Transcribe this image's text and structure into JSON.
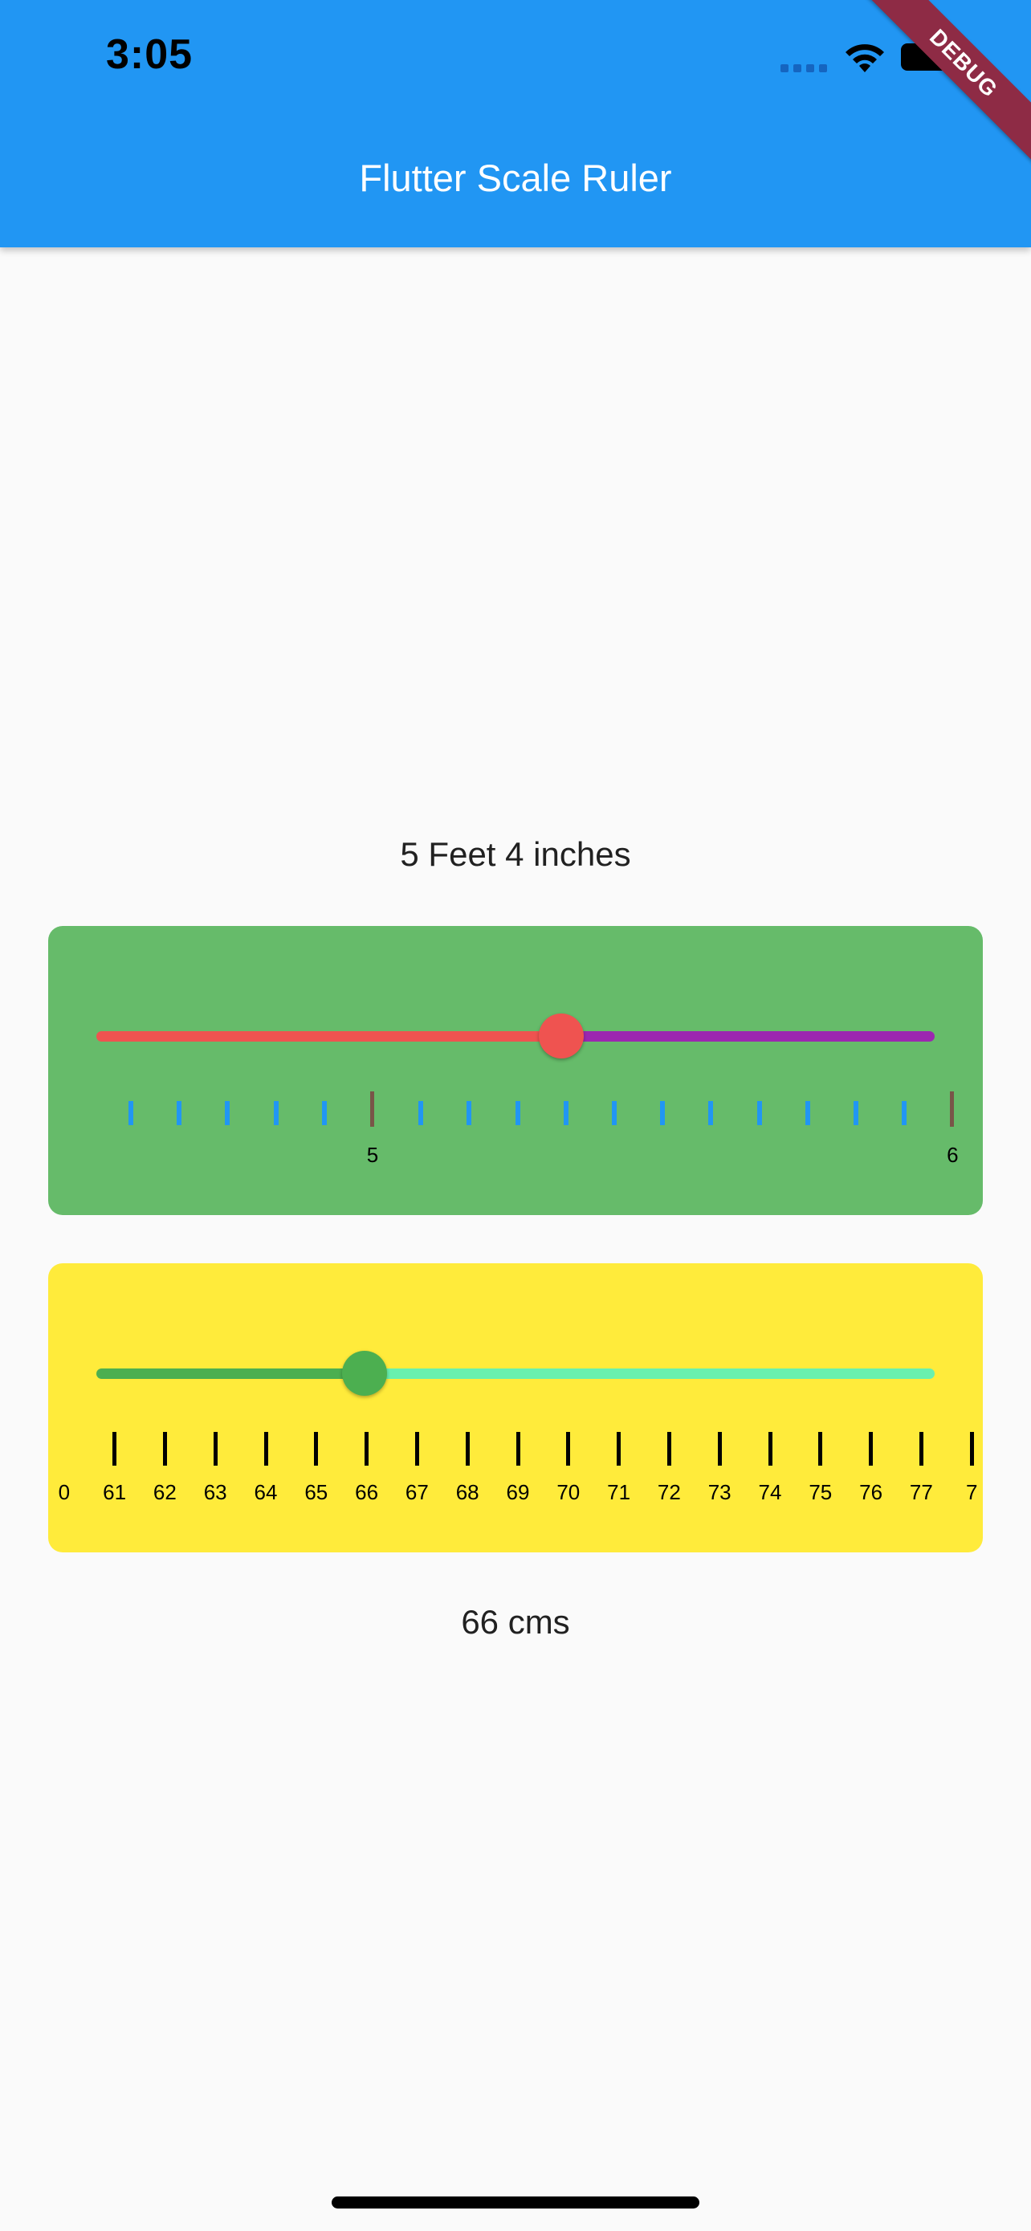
{
  "status_bar": {
    "time": "3:05",
    "icons": [
      "cellular-signal-icon",
      "wifi-icon",
      "battery-icon"
    ]
  },
  "app_bar": {
    "title": "Flutter Scale Ruler",
    "color": "#2196f3",
    "debug_banner": "DEBUG"
  },
  "feet_ruler": {
    "readout": "5 Feet 4 inches",
    "card_color": "#66bb6a",
    "active_track_color": "#ef5350",
    "inactive_track_color": "#9c27b0",
    "thumb_color": "#ef5350",
    "minor_tick_color": "#2196f3",
    "major_tick_color": "#795548",
    "slider_fraction": 0.555,
    "tick_labels": [
      {
        "tick_index": 5,
        "label": "5"
      },
      {
        "tick_index": 17,
        "label": "6"
      }
    ],
    "tick_count": 18
  },
  "cm_ruler": {
    "readout": "66 cms",
    "card_color": "#ffeb3b",
    "active_track_color": "#4caf50",
    "inactive_track_color": "#69f0ae",
    "thumb_color": "#4caf50",
    "tick_color": "#000000",
    "slider_fraction": 0.32,
    "labels": [
      "0",
      "61",
      "62",
      "63",
      "64",
      "65",
      "66",
      "67",
      "68",
      "69",
      "70",
      "71",
      "72",
      "73",
      "74",
      "75",
      "76",
      "77",
      "7"
    ]
  }
}
